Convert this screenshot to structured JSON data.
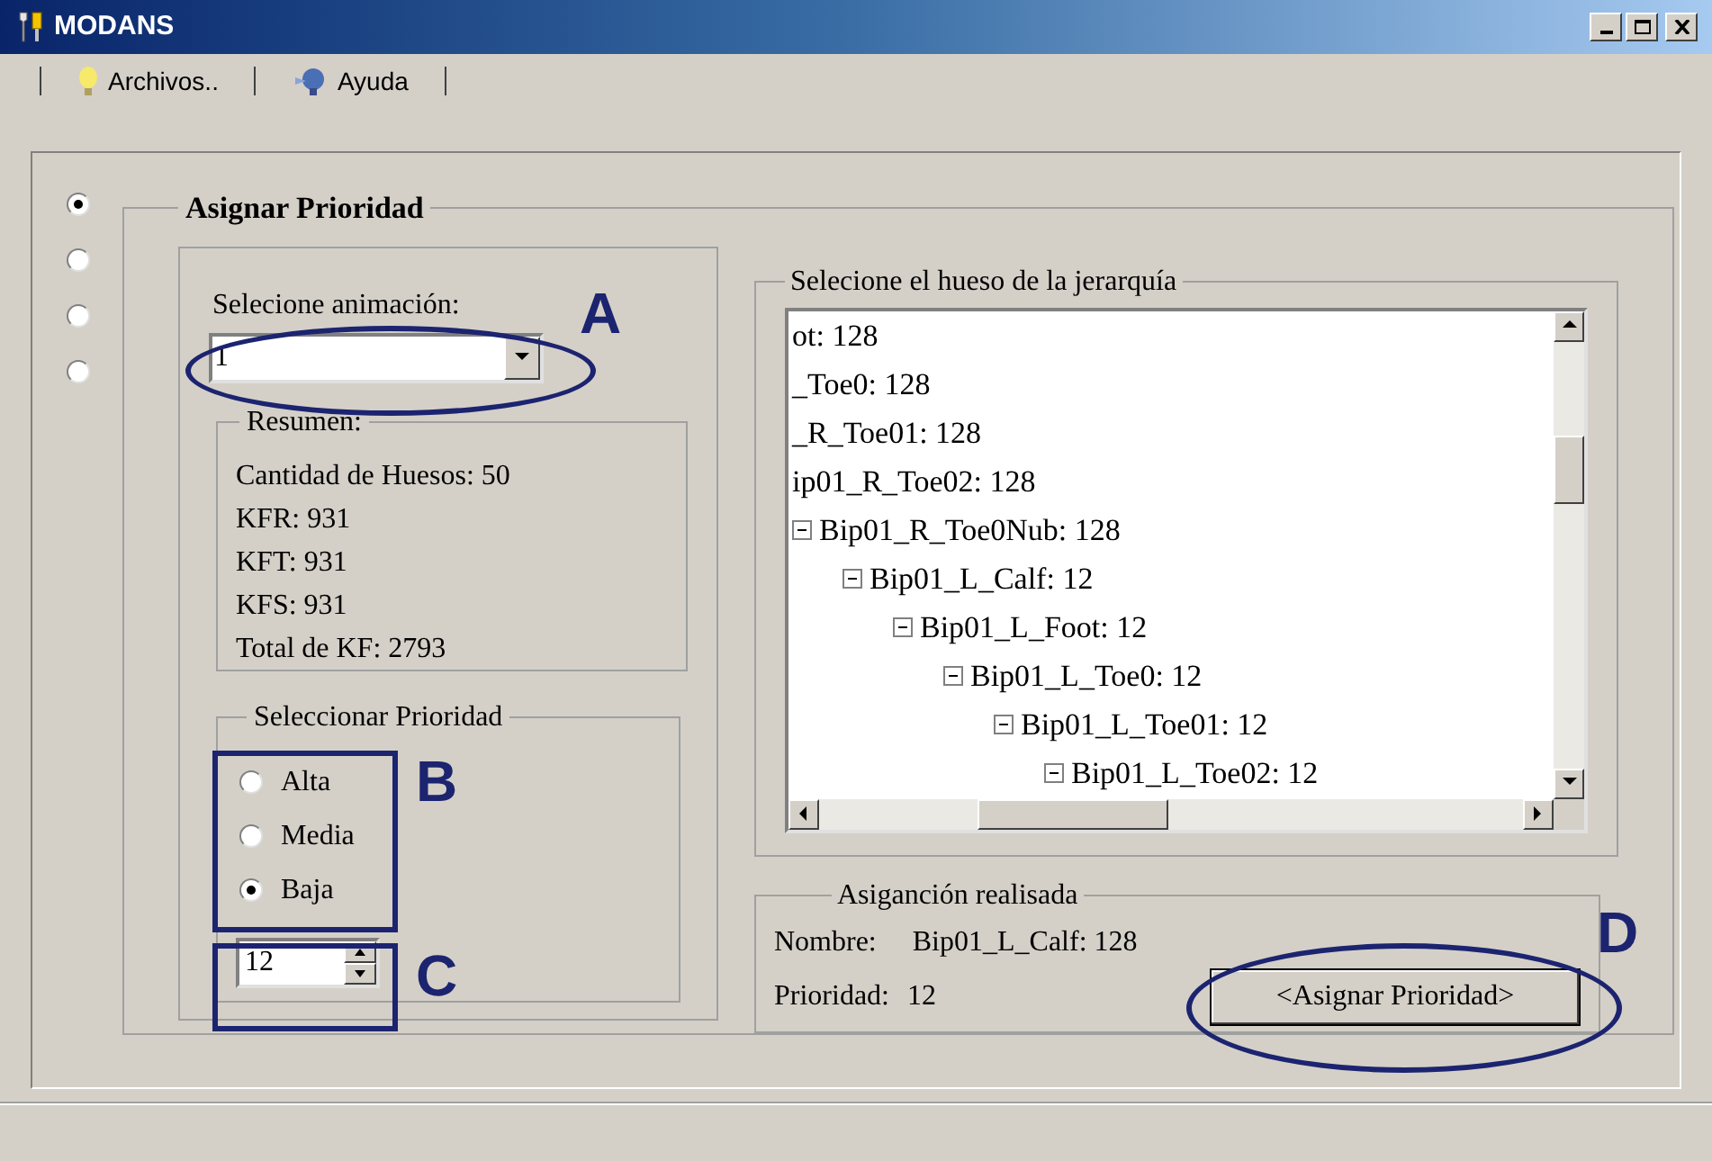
{
  "window": {
    "title": "MODANS"
  },
  "menu": [
    {
      "label": "Archivos.."
    },
    {
      "label": "Ayuda"
    }
  ],
  "mode_radios": [
    {
      "selected": true
    },
    {
      "selected": false
    },
    {
      "selected": false
    },
    {
      "selected": false
    }
  ],
  "group": {
    "title": "Asignar Prioridad"
  },
  "animation": {
    "label": "Selecione animación:",
    "value": "1"
  },
  "summary": {
    "title": "Resumen:",
    "lines": [
      "Cantidad de Huesos: 50",
      "KFR: 931",
      "KFT: 931",
      "KFS: 931",
      "Total de KF: 2793"
    ]
  },
  "priority": {
    "title": "Seleccionar Prioridad",
    "spinner_value": "12",
    "options": [
      {
        "label": "Alta",
        "selected": false
      },
      {
        "label": "Media",
        "selected": false
      },
      {
        "label": "Baja",
        "selected": true
      }
    ]
  },
  "tree": {
    "title": "Selecione el hueso de la jerarquía",
    "items": [
      {
        "label": "ot: 128"
      },
      {
        "label": "_Toe0: 128"
      },
      {
        "label": "_R_Toe01: 128"
      },
      {
        "label": "ip01_R_Toe02: 128"
      },
      {
        "label": "Bip01_R_Toe0Nub: 128",
        "expanded": true,
        "children": [
          {
            "label": "Bip01_L_Calf: 12",
            "expanded": true,
            "children": [
              {
                "label": "Bip01_L_Foot: 12",
                "expanded": true,
                "children": [
                  {
                    "label": "Bip01_L_Toe0: 12",
                    "expanded": true,
                    "children": [
                      {
                        "label": "Bip01_L_Toe01: 12",
                        "expanded": true,
                        "children": [
                          {
                            "label": "Bip01_L_Toe02: 12",
                            "expanded": true
                          }
                        ]
                      }
                    ]
                  }
                ]
              }
            ]
          }
        ]
      }
    ]
  },
  "result": {
    "title": "Asiganción realisada",
    "name_label": "Nombre:",
    "name_value": "Bip01_L_Calf: 128",
    "priority_label": "Prioridad:",
    "priority_value": "12",
    "button": "<Asignar Prioridad>"
  },
  "annotations": [
    {
      "label": "A",
      "kind": "ellipse"
    },
    {
      "label": "B",
      "kind": "rectangle"
    },
    {
      "label": "C",
      "kind": "rectangle"
    },
    {
      "label": "D",
      "kind": "ellipse"
    }
  ]
}
